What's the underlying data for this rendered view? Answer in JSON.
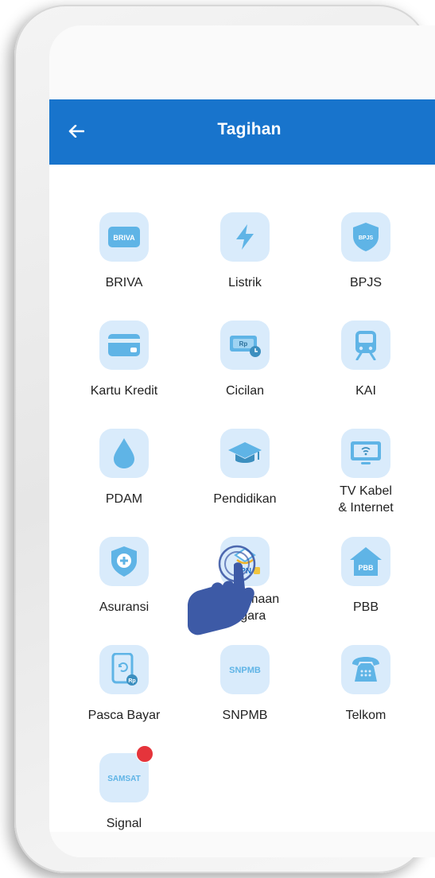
{
  "header": {
    "title": "Tagihan",
    "back_icon": "arrow-left-icon"
  },
  "colors": {
    "appbar": "#1874cc",
    "tile_bg": "#d9ebfb",
    "icon": "#5fb4e6",
    "badge": "#e5343b"
  },
  "menu": [
    {
      "label": "BRIVA",
      "icon": "briva-icon",
      "icon_text": "BRIVA"
    },
    {
      "label": "Listrik",
      "icon": "lightning-icon"
    },
    {
      "label": "BPJS",
      "icon": "shield-bpjs-icon",
      "icon_text": "BPJS"
    },
    {
      "label": "Kartu Kredit",
      "icon": "credit-card-icon"
    },
    {
      "label": "Cicilan",
      "icon": "money-bill-icon",
      "icon_text": "Rp"
    },
    {
      "label": "KAI",
      "icon": "train-icon"
    },
    {
      "label": "PDAM",
      "icon": "water-drop-icon"
    },
    {
      "label": "Pendidikan",
      "icon": "graduation-cap-icon"
    },
    {
      "label_line1": "TV Kabel",
      "label_line2": "& Internet",
      "icon": "tv-wifi-icon"
    },
    {
      "label": "Asuransi",
      "icon": "shield-plus-icon"
    },
    {
      "label_line1": "Penerimaan",
      "label_line2": "Negara",
      "icon": "mpn-icon",
      "icon_text": "MPN"
    },
    {
      "label": "PBB",
      "icon": "house-pbb-icon",
      "icon_text": "PBB"
    },
    {
      "label": "Pasca Bayar",
      "icon": "phone-refresh-icon",
      "icon_text": "Rp"
    },
    {
      "label": "SNPMB",
      "icon": "snpmb-icon",
      "icon_text": "SNPMB"
    },
    {
      "label": "Telkom",
      "icon": "telephone-icon"
    },
    {
      "label": "Signal",
      "icon": "samsat-icon",
      "icon_text": "SAMSAT",
      "has_badge": true
    }
  ]
}
